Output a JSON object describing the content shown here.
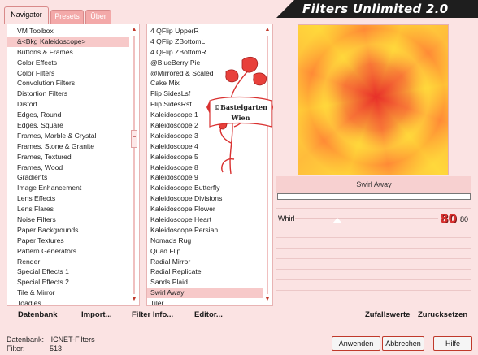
{
  "window": {
    "title": "Filters Unlimited 2.0"
  },
  "tabs": [
    {
      "label": "Navigator",
      "active": true
    },
    {
      "label": "Presets",
      "active": false
    },
    {
      "label": "Über",
      "active": false
    }
  ],
  "categories": {
    "items": [
      "VM Toolbox",
      "&<Bkg Kaleidoscope>",
      "Buttons & Frames",
      "Color Effects",
      "Color Filters",
      "Convolution Filters",
      "Distortion Filters",
      "Distort",
      "Edges, Round",
      "Edges, Square",
      "Frames, Marble & Crystal",
      "Frames, Stone & Granite",
      "Frames, Textured",
      "Frames, Wood",
      "Gradients",
      "Image Enhancement",
      "Lens Effects",
      "Lens Flares",
      "Noise Filters",
      "Paper Backgrounds",
      "Paper Textures",
      "Pattern Generators",
      "Render",
      "Special Effects 1",
      "Special Effects 2",
      "Tile & Mirror",
      "Toadies"
    ],
    "selected": "&<Bkg Kaleidoscope>"
  },
  "filters": {
    "items": [
      "4 QFlip UpperR",
      "4 QFlip ZBottomL",
      "4 QFlip ZBottomR",
      "@BlueBerry Pie",
      "@Mirrored & Scaled",
      "Cake Mix",
      "Flip SidesLsf",
      "Flip SidesRsf",
      "Kaleidoscope 1",
      "Kaleidoscope 2",
      "Kaleidoscope 3",
      "Kaleidoscope 4",
      "Kaleidoscope 5",
      "Kaleidoscope 8",
      "Kaleidoscope 9",
      "Kaleidoscope Butterfly",
      "Kaleidoscope Divisions",
      "Kaleidoscope Flower",
      "Kaleidoscope Heart",
      "Kaleidoscope Persian",
      "Nomads Rug",
      "Quad Flip",
      "Radial Mirror",
      "Radial Replicate",
      "Sands Plaid",
      "Swirl Away",
      "Tiler..."
    ],
    "selected": "Swirl Away"
  },
  "logo": {
    "line1": "©Bastelgarten",
    "line2": "Wien"
  },
  "toolbar": {
    "datenbank": "Datenbank",
    "import": "Import...",
    "filter_info": "Filter Info...",
    "editor": "Editor...",
    "random": "Zufallswerte",
    "reset": "Zurucksetzen"
  },
  "preview": {
    "filter_name": "Swirl Away"
  },
  "params": [
    {
      "label": "Whirl",
      "value": 80,
      "display": "80",
      "max": 255
    }
  ],
  "status": {
    "database_label": "Datenbank:",
    "database_value": "ICNET-Filters",
    "filter_label": "Filter:",
    "filter_value": "513"
  },
  "buttons": {
    "apply": "Anwenden",
    "cancel": "Abbrechen",
    "help": "Hilfe"
  },
  "colors": {
    "accent": "#c0392b",
    "panel": "#fbe3e3",
    "selection": "#f7c9c9",
    "banner": "#1e1e1e"
  }
}
